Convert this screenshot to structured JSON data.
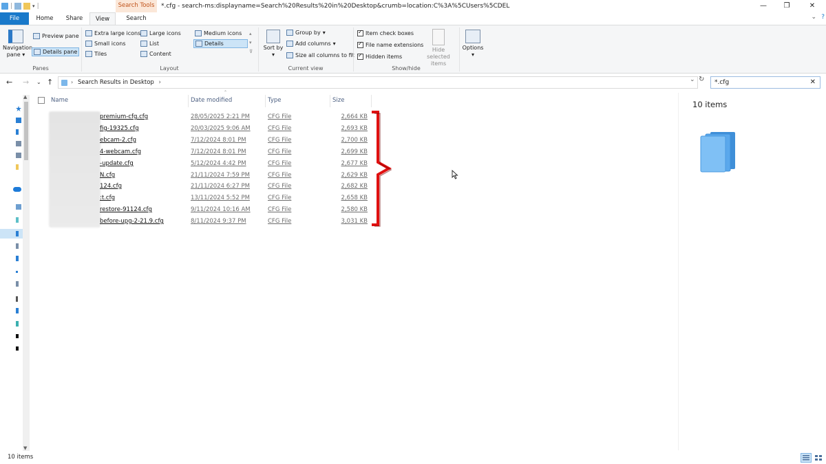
{
  "titlebar": {
    "context_tab": "Search Tools",
    "title": "*.cfg - search-ms:displayname=Search%20Results%20in%20Desktop&crumb=location:C%3A%5CUsers%5CDEL",
    "minimize": "—",
    "maximize": "❐",
    "close": "✕"
  },
  "tabs": {
    "file": "File",
    "home": "Home",
    "share": "Share",
    "view": "View",
    "search": "Search"
  },
  "ribbon": {
    "panes": {
      "label": "Panes",
      "navigation_pane": "Navigation pane",
      "preview_pane": "Preview pane",
      "details_pane": "Details pane"
    },
    "layout": {
      "label": "Layout",
      "extra_large_icons": "Extra large icons",
      "large_icons": "Large icons",
      "medium_icons": "Medium icons",
      "small_icons": "Small icons",
      "list": "List",
      "details": "Details",
      "tiles": "Tiles",
      "content": "Content"
    },
    "current_view": {
      "label": "Current view",
      "sort_by": "Sort by",
      "group_by": "Group by",
      "add_columns": "Add columns",
      "size_all_columns": "Size all columns to fit"
    },
    "show_hide": {
      "label": "Show/hide",
      "item_check_boxes": "Item check boxes",
      "file_name_extensions": "File name extensions",
      "hidden_items": "Hidden items",
      "hide_selected_items": "Hide selected items"
    },
    "options": "Options"
  },
  "address": {
    "crumb": "Search Results in Desktop",
    "search_value": "*.cfg"
  },
  "columns": {
    "name": "Name",
    "date_modified": "Date modified",
    "type": "Type",
    "size": "Size"
  },
  "files": [
    {
      "name": "premium-cfg.cfg",
      "date": "28/05/2025 2:21 PM",
      "type": "CFG File",
      "size": "2,664 KB"
    },
    {
      "name": "fig-19325.cfg",
      "date": "20/03/2025 9:06 AM",
      "type": "CFG File",
      "size": "2,693 KB"
    },
    {
      "name": "ebcam-2.cfg",
      "date": "7/12/2024 8:01 PM",
      "type": "CFG File",
      "size": "2,700 KB"
    },
    {
      "name": "4-webcam.cfg",
      "date": "7/12/2024 8:01 PM",
      "type": "CFG File",
      "size": "2,699 KB"
    },
    {
      "name": "-update.cfg",
      "date": "5/12/2024 4:42 PM",
      "type": "CFG File",
      "size": "2,677 KB"
    },
    {
      "name": "N.cfg",
      "date": "21/11/2024 7:59 PM",
      "type": "CFG File",
      "size": "2,629 KB"
    },
    {
      "name": "124.cfg",
      "date": "21/11/2024 6:27 PM",
      "type": "CFG File",
      "size": "2,682 KB"
    },
    {
      "name": ":t.cfg",
      "date": "13/11/2024 5:52 PM",
      "type": "CFG File",
      "size": "2,658 KB"
    },
    {
      "name": "restore-91124.cfg",
      "date": "9/11/2024 10:16 AM",
      "type": "CFG File",
      "size": "2,580 KB"
    },
    {
      "name": "before-upg-2-21.9.cfg",
      "date": "8/11/2024 9:37 PM",
      "type": "CFG File",
      "size": "3,031 KB"
    }
  ],
  "details_pane": {
    "count": "10 items"
  },
  "status": {
    "items": "10 items"
  },
  "colors": {
    "accent": "#1979ca",
    "bracket": "#e01010",
    "context_tab": "#c0531a"
  }
}
